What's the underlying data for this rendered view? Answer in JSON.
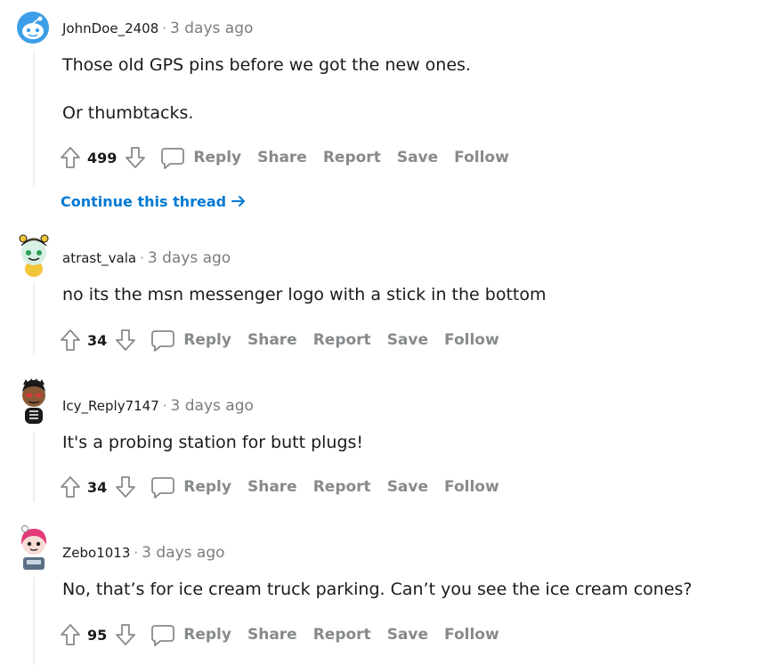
{
  "actions": {
    "reply": "Reply",
    "share": "Share",
    "report": "Report",
    "save": "Save",
    "follow": "Follow"
  },
  "continue_thread": "Continue this thread",
  "comments": [
    {
      "author": "JohnDoe_2408",
      "time": "3 days ago",
      "lines": [
        "Those old GPS pins before we got the new ones.",
        "Or thumbtacks."
      ],
      "score": "499",
      "avatar_icon": "snoo-default-blue-icon"
    },
    {
      "author": "atrast_vala",
      "time": "3 days ago",
      "lines": [
        "no its the msn messenger logo with a stick in the bottom"
      ],
      "score": "34",
      "avatar_icon": "snoo-yellow-hat-icon"
    },
    {
      "author": "Icy_Reply7147",
      "time": "3 days ago",
      "lines": [
        "It's a probing station for butt plugs!"
      ],
      "score": "34",
      "avatar_icon": "snoo-skeleton-icon"
    },
    {
      "author": "Zebo1013",
      "time": "3 days ago",
      "lines": [
        "No, that’s for ice cream truck parking. Can’t you see the ice cream cones?"
      ],
      "score": "95",
      "avatar_icon": "snoo-pink-hair-icon"
    }
  ],
  "colors": {
    "accent": "#0079d3",
    "muted": "#878a8c",
    "thread_line": "#edeff1"
  }
}
